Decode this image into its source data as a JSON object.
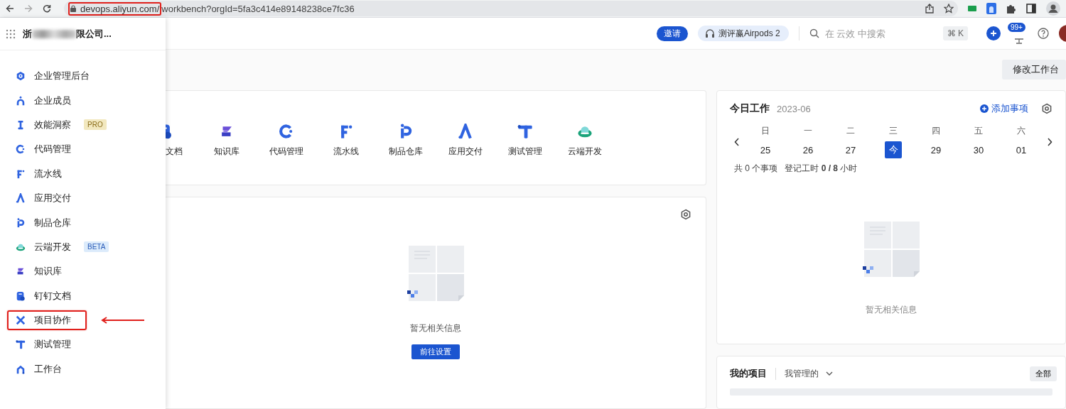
{
  "browser": {
    "url_host": "devops.aliyun.com/",
    "url_path": "workbench?orgId=5fa3c414e89148238ce7fc36",
    "host_highlighted": true
  },
  "org": {
    "name_start": "浙",
    "name_end": "限公司..."
  },
  "sidebar": {
    "items": [
      {
        "label": "企业管理后台",
        "highlighted": false
      },
      {
        "label": "企业成员",
        "highlighted": false
      },
      {
        "label": "效能洞察",
        "highlighted": false,
        "badge": {
          "text": "PRO",
          "kind": "pro"
        }
      },
      {
        "label": "代码管理",
        "highlighted": false
      },
      {
        "label": "流水线",
        "highlighted": false
      },
      {
        "label": "应用交付",
        "highlighted": false
      },
      {
        "label": "制品仓库",
        "highlighted": false
      },
      {
        "label": "云端开发",
        "highlighted": false,
        "badge": {
          "text": "BETA",
          "kind": "beta"
        }
      },
      {
        "label": "知识库",
        "highlighted": false
      },
      {
        "label": "钉钉文档",
        "highlighted": false
      },
      {
        "label": "项目协作",
        "highlighted": true
      },
      {
        "label": "测试管理",
        "highlighted": false
      },
      {
        "label": "工作台",
        "highlighted": false
      }
    ]
  },
  "header": {
    "invite": "邀请",
    "promo": "测评赢Airpods 2",
    "search_placeholder": "在 云效 中搜索",
    "shortcut": "⌘ K",
    "notification_count": "99+"
  },
  "toolbar": {
    "edit_button": "修改工作台"
  },
  "apps": [
    {
      "label": "文档"
    },
    {
      "label": "知识库"
    },
    {
      "label": "代码管理"
    },
    {
      "label": "流水线"
    },
    {
      "label": "制品仓库"
    },
    {
      "label": "应用交付"
    },
    {
      "label": "测试管理"
    },
    {
      "label": "云端开发"
    }
  ],
  "notice_card": {
    "empty_text": "暂无相关信息",
    "button": "前往设置"
  },
  "today": {
    "title": "今日工作",
    "month": "2023-06",
    "add": "添加事项",
    "weekdays": [
      "日",
      "一",
      "二",
      "三",
      "四",
      "五",
      "六"
    ],
    "dates": [
      {
        "label": "25",
        "selected": false
      },
      {
        "label": "26",
        "selected": false
      },
      {
        "label": "27",
        "selected": false
      },
      {
        "label": "今",
        "selected": true
      },
      {
        "label": "29",
        "selected": false
      },
      {
        "label": "30",
        "selected": false
      },
      {
        "label": "01",
        "selected": false
      }
    ],
    "item_count": "共 0 个事项",
    "hours": "登记工时 **0 / 8** 小时",
    "empty_text": "暂无相关信息"
  },
  "projects": {
    "title": "我的项目",
    "filter": "我管理的",
    "all_button": "全部"
  }
}
